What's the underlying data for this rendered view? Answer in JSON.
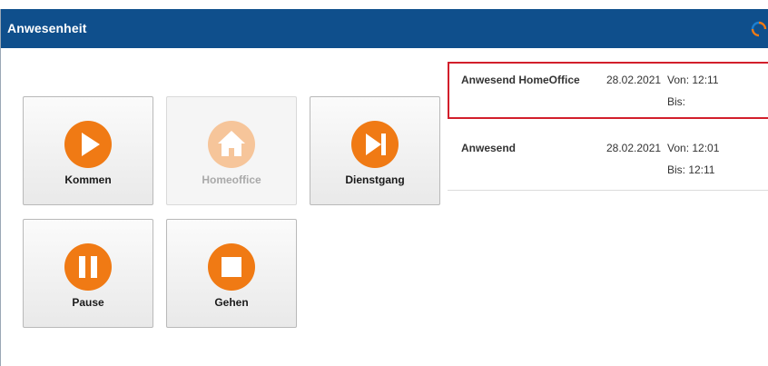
{
  "header": {
    "title": "Anwesenheit",
    "refresh_icon": "refresh-icon"
  },
  "buttons": [
    {
      "label": "Kommen",
      "icon": "play-icon",
      "enabled": true
    },
    {
      "label": "Homeoffice",
      "icon": "home-icon",
      "enabled": false
    },
    {
      "label": "Dienstgang",
      "icon": "skip-forward-icon",
      "enabled": true
    },
    {
      "label": "Pause",
      "icon": "pause-icon",
      "enabled": true
    },
    {
      "label": "Gehen",
      "icon": "stop-icon",
      "enabled": true
    }
  ],
  "entries": [
    {
      "type": "Anwesend HomeOffice",
      "date": "28.02.2021",
      "von": "Von: 12:11",
      "bis": "Bis:",
      "highlighted": true
    },
    {
      "type": "Anwesend",
      "date": "28.02.2021",
      "von": "Von: 12:01",
      "bis": "Bis: 12:11",
      "highlighted": false
    }
  ],
  "colors": {
    "header_bg": "#0f4f8c",
    "accent_orange": "#f07a14",
    "disabled_orange": "#f6c59a",
    "highlight_border": "#d21f2b"
  }
}
